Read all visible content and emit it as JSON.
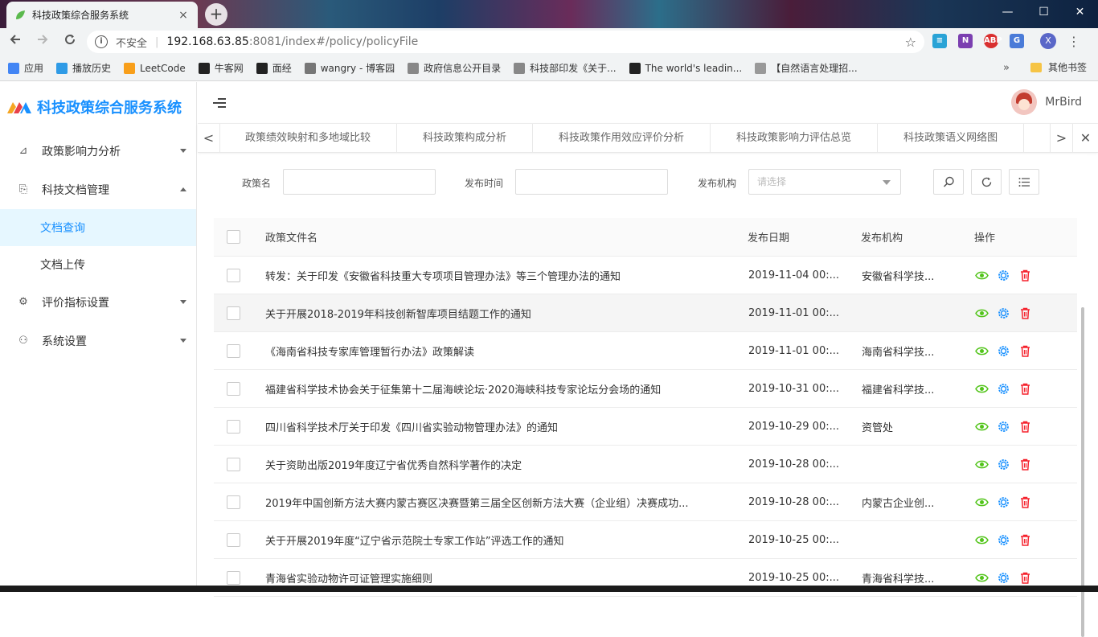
{
  "browser": {
    "tab_title": "科技政策综合服务系统",
    "tab_close": "×",
    "new_tab": "+",
    "window_controls": [
      "—",
      "☐",
      "✕"
    ],
    "insecure_label": "不安全",
    "url_host": "192.168.63.85",
    "url_path": ":8081/index#/policy/policyFile",
    "profile_letter": "X",
    "bookmarks": [
      {
        "label": "应用",
        "icon": "apps-grid-icon",
        "color": "#4285f4"
      },
      {
        "label": "播放历史",
        "icon": "tv-icon",
        "color": "#2f9be6"
      },
      {
        "label": "LeetCode",
        "icon": "leetcode-icon",
        "color": "#f89f1b"
      },
      {
        "label": "牛客网",
        "icon": "nowcoder-icon",
        "color": "#222222"
      },
      {
        "label": "面经",
        "icon": "github-icon",
        "color": "#222222"
      },
      {
        "label": "wangry - 博客园",
        "icon": "cnblogs-icon",
        "color": "#777777"
      },
      {
        "label": "政府信息公开目录",
        "icon": "globe-icon",
        "color": "#888888"
      },
      {
        "label": "科技部印发《关于...",
        "icon": "globe-icon",
        "color": "#888888"
      },
      {
        "label": "The world's leadin...",
        "icon": "github-icon",
        "color": "#222222"
      },
      {
        "label": "【自然语言处理招...",
        "icon": "hand-icon",
        "color": "#999999"
      }
    ],
    "more_bookmarks": "»",
    "other_bookmarks": "其他书签"
  },
  "app": {
    "system_name": "科技政策综合服务系统",
    "user_name": "MrBird",
    "brand_color": "#1890ff"
  },
  "sidebar": {
    "items": [
      {
        "label": "政策影响力分析",
        "icon": "chart-icon",
        "glyph": "⊿",
        "expanded": false
      },
      {
        "label": "科技文档管理",
        "icon": "document-search-icon",
        "glyph": "⎘",
        "expanded": true,
        "children": [
          {
            "label": "文档查询",
            "active": true
          },
          {
            "label": "文档上传",
            "active": false
          }
        ]
      },
      {
        "label": "评价指标设置",
        "icon": "settings-icon",
        "glyph": "⚙",
        "expanded": false
      },
      {
        "label": "系统设置",
        "icon": "user-icon",
        "glyph": "⚇",
        "expanded": false
      }
    ]
  },
  "page_tabs": {
    "left_arrow": "<",
    "right_arrow": ">",
    "close": "✕",
    "tabs": [
      "政策绩效映射和多地域比较",
      "科技政策构成分析",
      "科技政策作用效应评价分析",
      "科技政策影响力评估总览",
      "科技政策语义网络图"
    ]
  },
  "filters": {
    "policy_name_label": "政策名",
    "publish_time_label": "发布时间",
    "agency_label": "发布机构",
    "agency_placeholder": "请选择",
    "search_glyph": "⌕",
    "reset_glyph": "↻",
    "columns_glyph": "☰"
  },
  "table": {
    "headers": {
      "name": "政策文件名",
      "date": "发布日期",
      "agency": "发布机构",
      "ops": "操作"
    },
    "op_glyphs": {
      "view": "◉",
      "edit": "⚙",
      "delete": "🗑"
    },
    "rows": [
      {
        "name": "转发：关于印发《安徽省科技重大专项项目管理办法》等三个管理办法的通知",
        "date": "2019-11-04 00:...",
        "agency": "安徽省科学技..."
      },
      {
        "name": "关于开展2018-2019年科技创新智库项目结题工作的通知",
        "date": "2019-11-01 00:...",
        "agency": ""
      },
      {
        "name": "《海南省科技专家库管理暂行办法》政策解读",
        "date": "2019-11-01 00:...",
        "agency": "海南省科学技..."
      },
      {
        "name": "福建省科学技术协会关于征集第十二届海峡论坛·2020海峡科技专家论坛分会场的通知",
        "date": "2019-10-31 00:...",
        "agency": "福建省科学技..."
      },
      {
        "name": "四川省科学技术厅关于印发《四川省实验动物管理办法》的通知",
        "date": "2019-10-29 00:...",
        "agency": "资管处"
      },
      {
        "name": "关于资助出版2019年度辽宁省优秀自然科学著作的决定",
        "date": "2019-10-28 00:...",
        "agency": ""
      },
      {
        "name": "2019年中国创新方法大赛内蒙古赛区决赛暨第三届全区创新方法大赛（企业组）决赛成功...",
        "date": "2019-10-28 00:...",
        "agency": "内蒙古企业创..."
      },
      {
        "name": "关于开展2019年度“辽宁省示范院士专家工作站”评选工作的通知",
        "date": "2019-10-25 00:...",
        "agency": ""
      },
      {
        "name": "青海省实验动物许可证管理实施细则",
        "date": "2019-10-25 00:...",
        "agency": "青海省科学技..."
      }
    ]
  }
}
